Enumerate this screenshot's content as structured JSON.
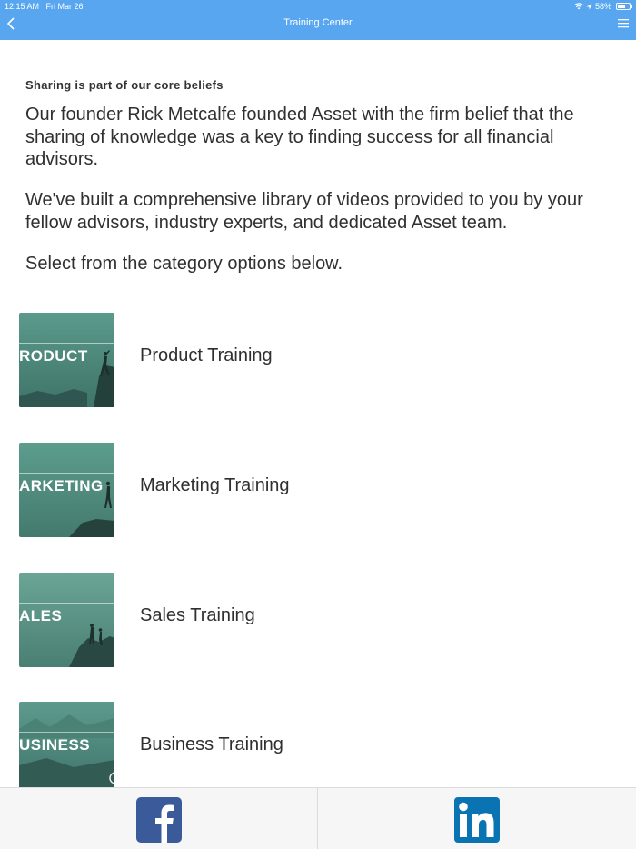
{
  "status_bar": {
    "time": "12:15 AM",
    "date": "Fri Mar 26",
    "battery": "58%"
  },
  "nav": {
    "title": "Training Center"
  },
  "intro": {
    "heading": "Sharing is part of our core beliefs",
    "paragraph1": "Our founder Rick Metcalfe founded Asset with the firm belief that the sharing of knowledge was a key to finding success for all financial advisors.",
    "paragraph2": "We've built a comprehensive library of videos provided to you by your fellow advisors, industry experts, and dedicated Asset team.",
    "paragraph3": "Select from the category options below."
  },
  "categories": [
    {
      "thumb_text": "RODUCT",
      "label": "Product Training"
    },
    {
      "thumb_text": "ARKETING",
      "label": "Marketing Training"
    },
    {
      "thumb_text": "ALES",
      "label": "Sales Training"
    },
    {
      "thumb_text": "USINESS",
      "label": "Business Training"
    }
  ],
  "footer": {
    "facebook_icon": "facebook-icon",
    "linkedin_icon": "linkedin-icon"
  },
  "colors": {
    "nav_bar": "#58a6f0",
    "thumb_teal": "#4f8a80",
    "facebook": "#3b5a9a",
    "linkedin": "#0a73b1"
  }
}
